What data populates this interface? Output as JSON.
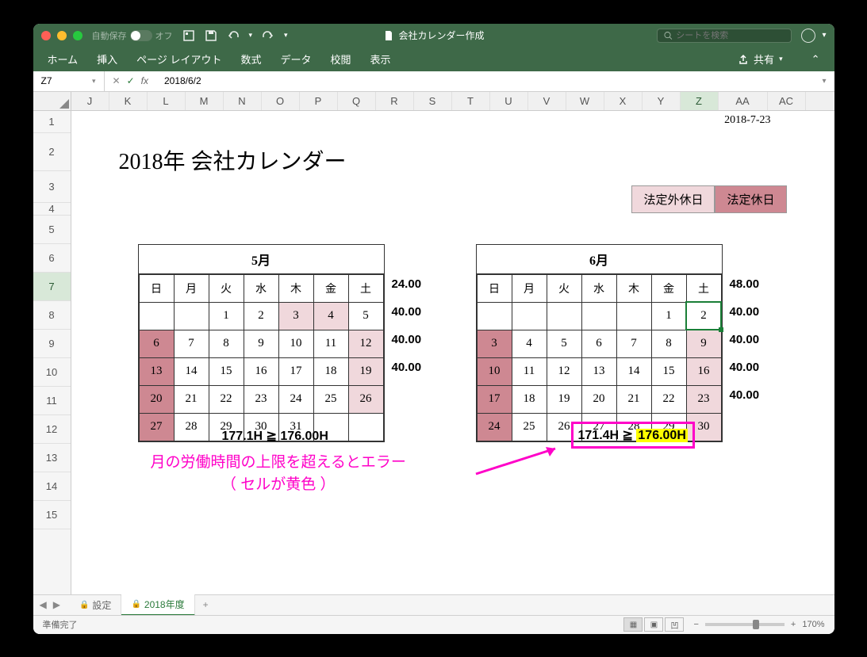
{
  "titlebar": {
    "autosave_label": "自動保存",
    "autosave_state": "オフ",
    "doc_title": "会社カレンダー作成",
    "search_placeholder": "シートを検索"
  },
  "ribbon": {
    "tabs": [
      "ホーム",
      "挿入",
      "ページ レイアウト",
      "数式",
      "データ",
      "校閲",
      "表示"
    ],
    "share": "共有"
  },
  "namebox": {
    "cell": "Z7",
    "formula": "2018/6/2"
  },
  "columns": [
    "J",
    "K",
    "L",
    "M",
    "N",
    "O",
    "P",
    "Q",
    "R",
    "S",
    "T",
    "U",
    "V",
    "W",
    "X",
    "Y",
    "Z",
    "AA",
    "AC"
  ],
  "rows": [
    "1",
    "2",
    "3",
    "4",
    "5",
    "6",
    "7",
    "8",
    "9",
    "10",
    "11",
    "12",
    "13",
    "14",
    "15"
  ],
  "content": {
    "date": "2018-7-23",
    "title": "2018年 会社カレンダー",
    "legend": [
      "法定外休日",
      "法定休日"
    ],
    "days": [
      "日",
      "月",
      "火",
      "水",
      "木",
      "金",
      "土"
    ],
    "may": {
      "title": "5月",
      "weeks": [
        [
          "",
          "",
          "1",
          "2",
          "3",
          "4",
          "5"
        ],
        [
          "6",
          "7",
          "8",
          "9",
          "10",
          "11",
          "12"
        ],
        [
          "13",
          "14",
          "15",
          "16",
          "17",
          "18",
          "19"
        ],
        [
          "20",
          "21",
          "22",
          "23",
          "24",
          "25",
          "26"
        ],
        [
          "27",
          "28",
          "29",
          "30",
          "31",
          "",
          ""
        ]
      ],
      "sundays": [
        "6",
        "13",
        "20",
        "27"
      ],
      "sat_hols": [
        "3",
        "4",
        "12",
        "19",
        "26"
      ],
      "hours": [
        "24.00",
        "40.00",
        "40.00",
        "40.00"
      ],
      "summary": "177.1H ≧ 176.00H"
    },
    "jun": {
      "title": "6月",
      "weeks": [
        [
          "",
          "",
          "",
          "",
          "",
          "1",
          "2"
        ],
        [
          "3",
          "4",
          "5",
          "6",
          "7",
          "8",
          "9"
        ],
        [
          "10",
          "11",
          "12",
          "13",
          "14",
          "15",
          "16"
        ],
        [
          "17",
          "18",
          "19",
          "20",
          "21",
          "22",
          "23"
        ],
        [
          "24",
          "25",
          "26",
          "27",
          "28",
          "29",
          "30"
        ]
      ],
      "sundays": [
        "3",
        "10",
        "17",
        "24"
      ],
      "sat_hols": [
        "9",
        "16",
        "23",
        "30"
      ],
      "hours": [
        "48.00",
        "40.00",
        "40.00",
        "40.00",
        "40.00"
      ],
      "summary_left": "171.4H ≧ ",
      "summary_right": "176.00H"
    },
    "annotation_l1": "月の労働時間の上限を超えるとエラー",
    "annotation_l2": "（ セルが黄色 ）"
  },
  "tabs": {
    "t1": "設定",
    "t2": "2018年度"
  },
  "status": {
    "ready": "準備完了",
    "zoom": "170%"
  }
}
